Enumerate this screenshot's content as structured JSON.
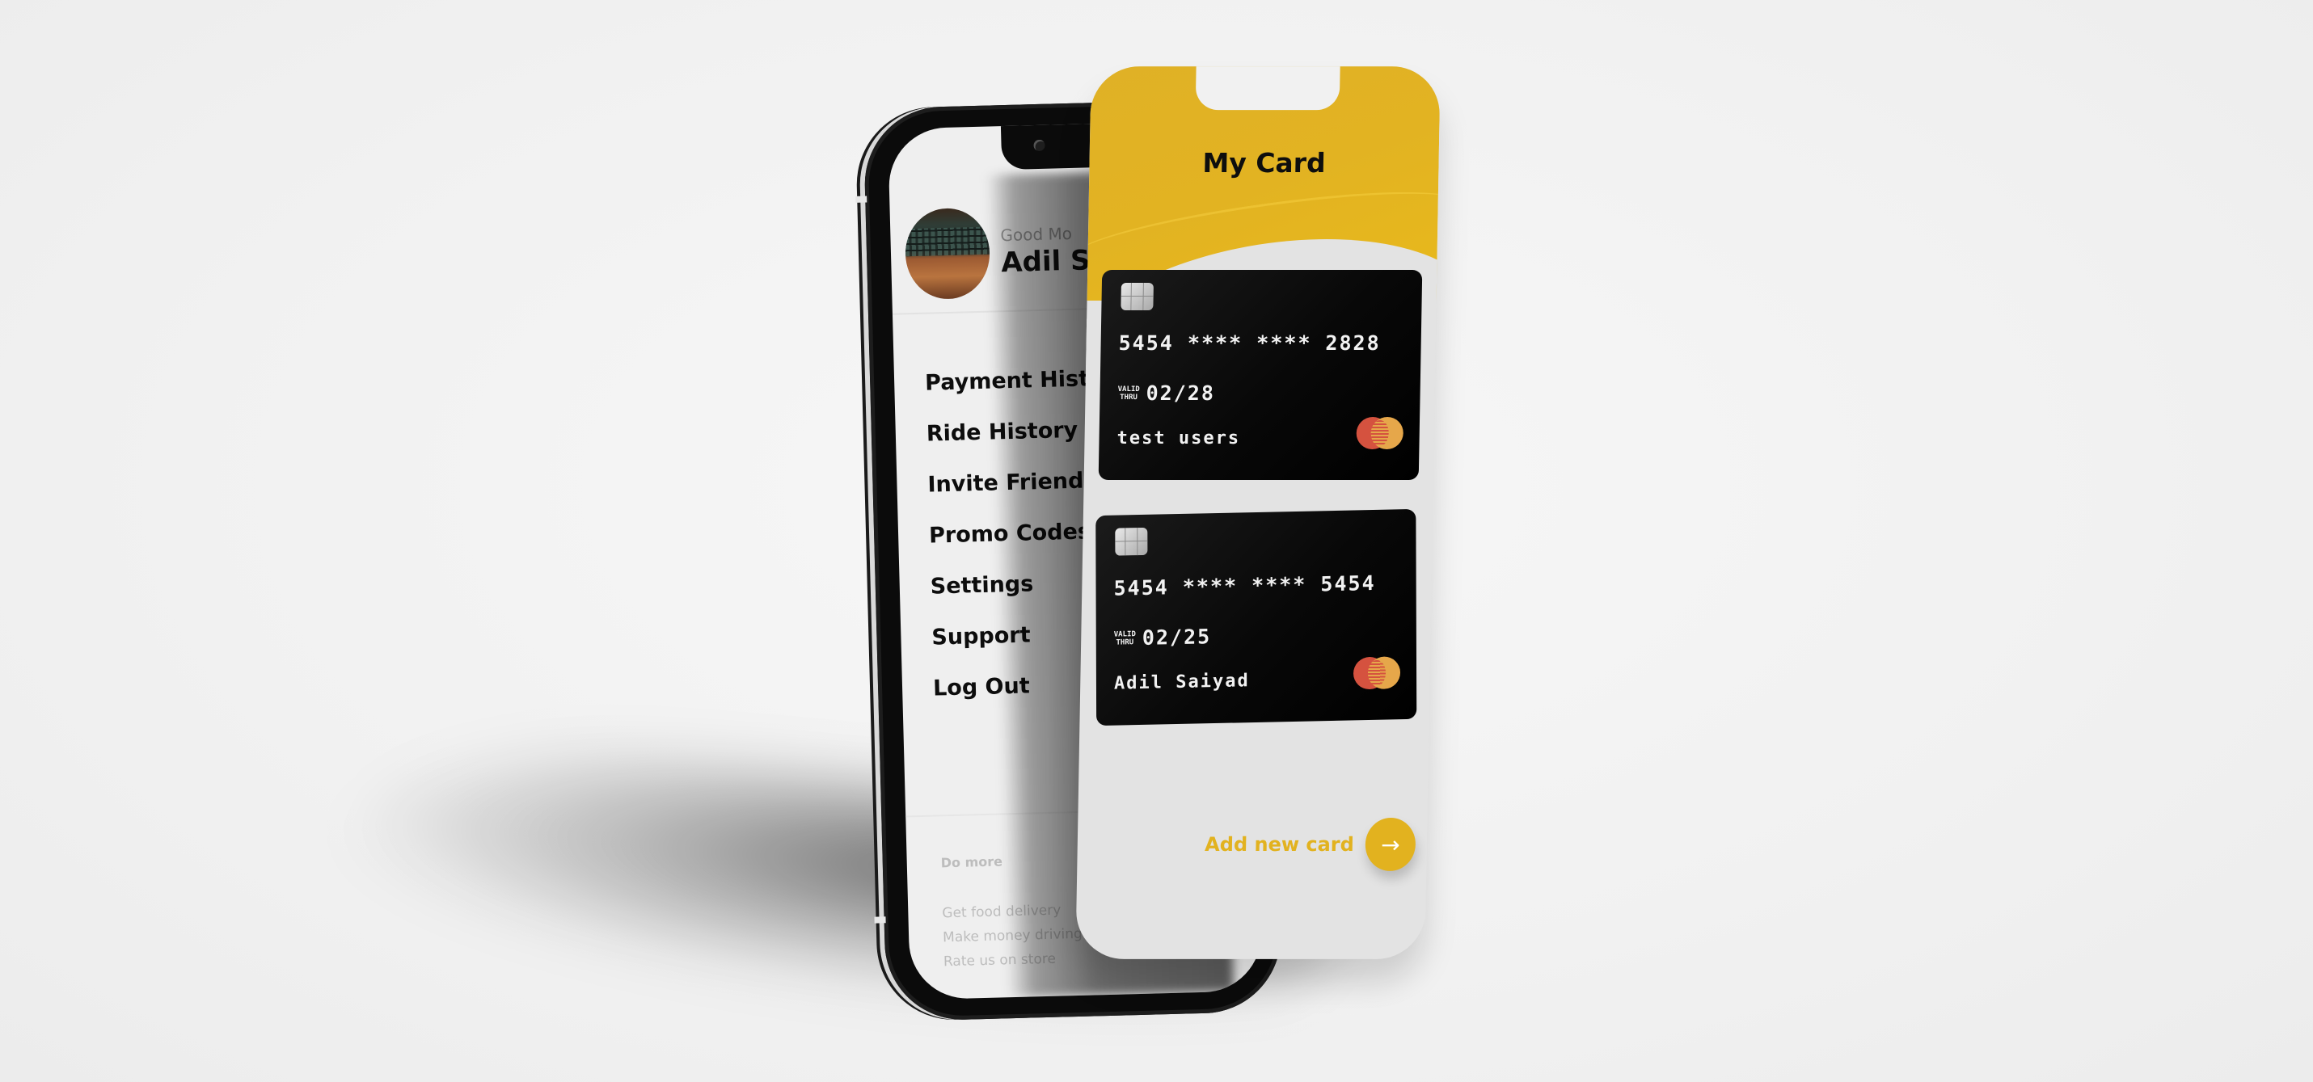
{
  "back_screen": {
    "greeting": "Good Mo",
    "username": "Adil S",
    "menu": [
      {
        "label": "Payment Hist"
      },
      {
        "label": "Ride History"
      },
      {
        "label": "Invite Friends"
      },
      {
        "label": "Promo Codes"
      },
      {
        "label": "Settings"
      },
      {
        "label": "Support"
      },
      {
        "label": "Log Out"
      }
    ],
    "do_more": {
      "title": "Do more",
      "items": [
        "Get food delivery",
        "Make money driving",
        "Rate us on store"
      ]
    }
  },
  "front_screen": {
    "title": "My Card",
    "cards": [
      {
        "number": "5454 **** **** 2828",
        "valid_label_top": "VALID",
        "valid_label_bottom": "THRU",
        "expiry": "02/28",
        "holder": "test users",
        "brand": "mastercard-icon"
      },
      {
        "number": "5454 **** **** 5454",
        "valid_label_top": "VALID",
        "valid_label_bottom": "THRU",
        "expiry": "02/25",
        "holder": "Adil Saiyad",
        "brand": "mastercard-icon"
      }
    ],
    "add_card_label": "Add new card",
    "add_card_icon": "→"
  },
  "colors": {
    "accent": "#e2b21f",
    "card_bg": "#0a0a0a",
    "mastercard_red": "#d5523f",
    "mastercard_orange": "#e6a74a"
  }
}
